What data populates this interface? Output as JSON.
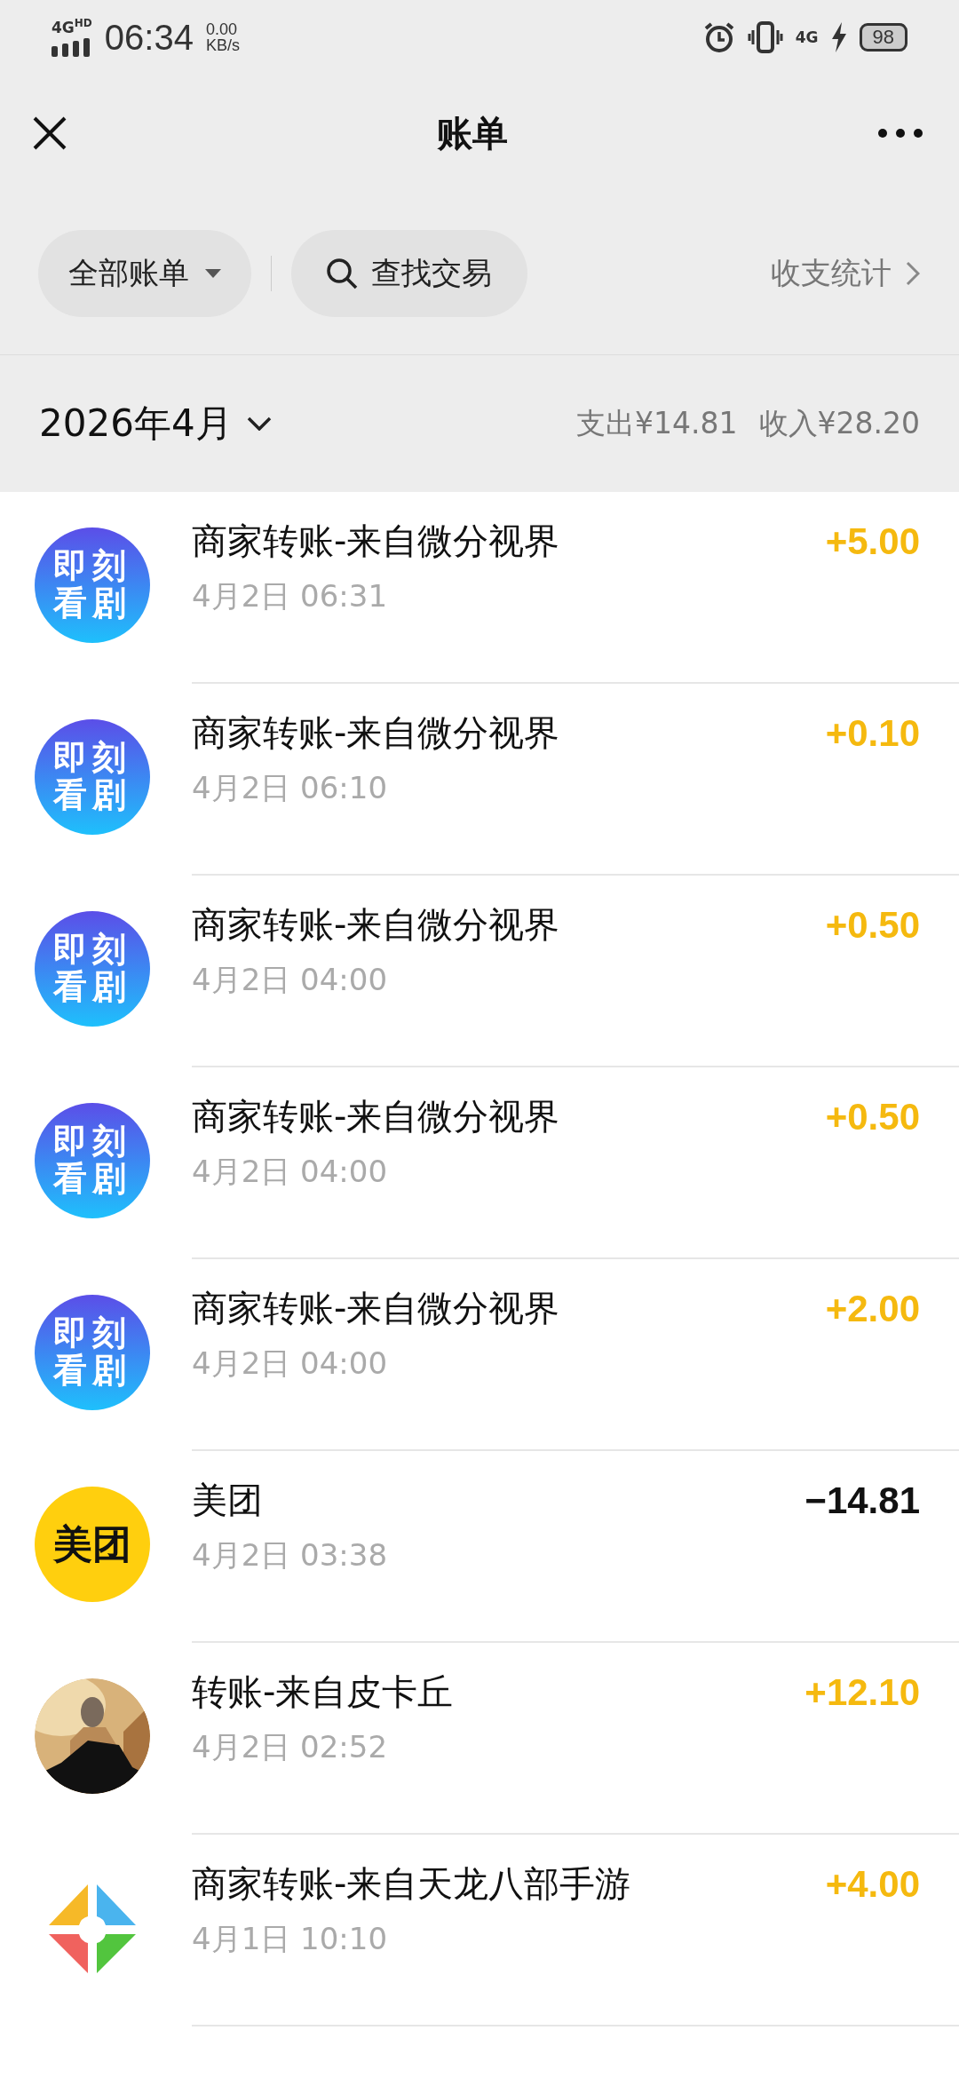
{
  "status_bar": {
    "network": "4G",
    "network_badge": "HD",
    "time": "06:34",
    "speed_value": "0.00",
    "speed_unit": "KB/s",
    "data_badge": "4G",
    "battery": "98"
  },
  "header": {
    "title": "账单"
  },
  "filters": {
    "category": "全部账单",
    "search": "查找交易",
    "stats": "收支统计"
  },
  "month": {
    "label": "2026年4月",
    "expense": "支出¥14.81",
    "income": "收入¥28.20"
  },
  "transactions": [
    {
      "avatar": {
        "kind": "badge",
        "lines": [
          "即刻",
          "看剧"
        ]
      },
      "title": "商家转账-来自微分视界",
      "time": "4月2日 06:31",
      "amount": "+5.00",
      "income": true
    },
    {
      "avatar": {
        "kind": "badge",
        "lines": [
          "即刻",
          "看剧"
        ]
      },
      "title": "商家转账-来自微分视界",
      "time": "4月2日 06:10",
      "amount": "+0.10",
      "income": true
    },
    {
      "avatar": {
        "kind": "badge",
        "lines": [
          "即刻",
          "看剧"
        ]
      },
      "title": "商家转账-来自微分视界",
      "time": "4月2日 04:00",
      "amount": "+0.50",
      "income": true
    },
    {
      "avatar": {
        "kind": "badge",
        "lines": [
          "即刻",
          "看剧"
        ]
      },
      "title": "商家转账-来自微分视界",
      "time": "4月2日 04:00",
      "amount": "+0.50",
      "income": true
    },
    {
      "avatar": {
        "kind": "badge",
        "lines": [
          "即刻",
          "看剧"
        ]
      },
      "title": "商家转账-来自微分视界",
      "time": "4月2日 04:00",
      "amount": "+2.00",
      "income": true
    },
    {
      "avatar": {
        "kind": "wordmark",
        "text": "美团"
      },
      "title": "美团",
      "time": "4月2日 03:38",
      "amount": "−14.81",
      "income": false
    },
    {
      "title": "转账-来自皮卡丘",
      "time": "4月2日 02:52",
      "amount": "+12.10",
      "income": true
    },
    {
      "avatar": {
        "kind": "pinwheel"
      },
      "title": "商家转账-来自天龙八部手游",
      "time": "4月1日 10:10",
      "amount": "+4.00",
      "income": true
    }
  ]
}
